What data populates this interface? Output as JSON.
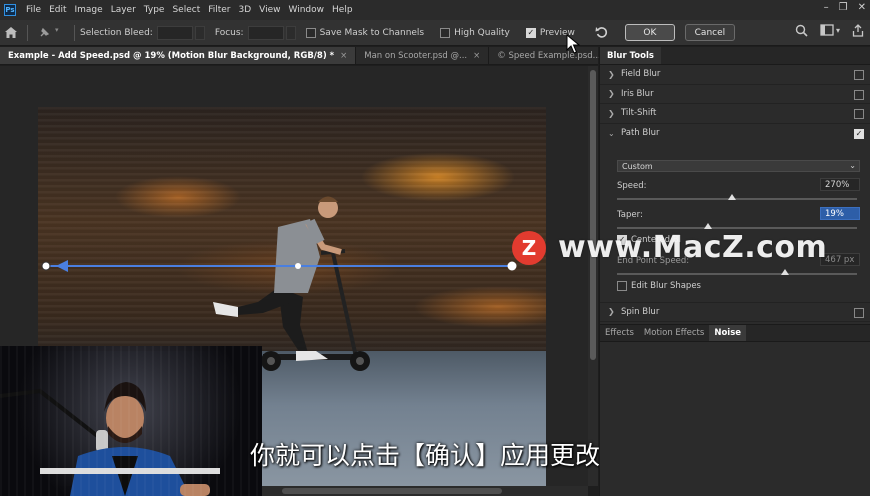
{
  "menubar": {
    "items": [
      "File",
      "Edit",
      "Image",
      "Layer",
      "Type",
      "Select",
      "Filter",
      "3D",
      "View",
      "Window",
      "Help"
    ]
  },
  "options": {
    "selection_bleed_label": "Selection Bleed:",
    "focus_label": "Focus:",
    "save_mask_label": "Save Mask to Channels",
    "high_quality_label": "High Quality",
    "preview_label": "Preview",
    "ok_label": "OK",
    "cancel_label": "Cancel"
  },
  "tabs": [
    {
      "label": "Example - Add Speed.psd @ 19% (Motion Blur Background, RGB/8) *",
      "close": "×"
    },
    {
      "label": "Man on Scooter.psd @...",
      "close": "×"
    },
    {
      "label": "© Speed Example.psd...",
      "close": "×"
    }
  ],
  "panel": {
    "tab": "Blur Tools",
    "items": [
      {
        "label": "Field Blur",
        "checked": false,
        "expanded": false
      },
      {
        "label": "Iris Blur",
        "checked": false,
        "expanded": false
      },
      {
        "label": "Tilt-Shift",
        "checked": false,
        "expanded": false
      },
      {
        "label": "Path Blur",
        "checked": true,
        "expanded": true
      }
    ],
    "preset": "Custom",
    "speed_label": "Speed:",
    "speed_value": "270%",
    "speed_level": 0.48,
    "taper_label": "Taper:",
    "taper_value": "19%",
    "taper_level": 0.38,
    "centered_blur_label": "Centered Bl",
    "end_point_label": "End Point Speed:",
    "end_point_value": "467 px",
    "end_point_level": 0.7,
    "edit_shapes_label": "Edit Blur Shapes",
    "spin_blur_label": "Spin Blur",
    "bottom_tabs": [
      "Effects",
      "Motion Effects",
      "Noise"
    ],
    "bottom_active": "Noise"
  },
  "subtitle": "你就可以点击【确认】应用更改",
  "watermark": {
    "logo_letter": "Z",
    "text": "www.MacZ.com"
  },
  "colors": {
    "accent": "#2d5ea8",
    "watermark_red": "#e23b2f"
  }
}
